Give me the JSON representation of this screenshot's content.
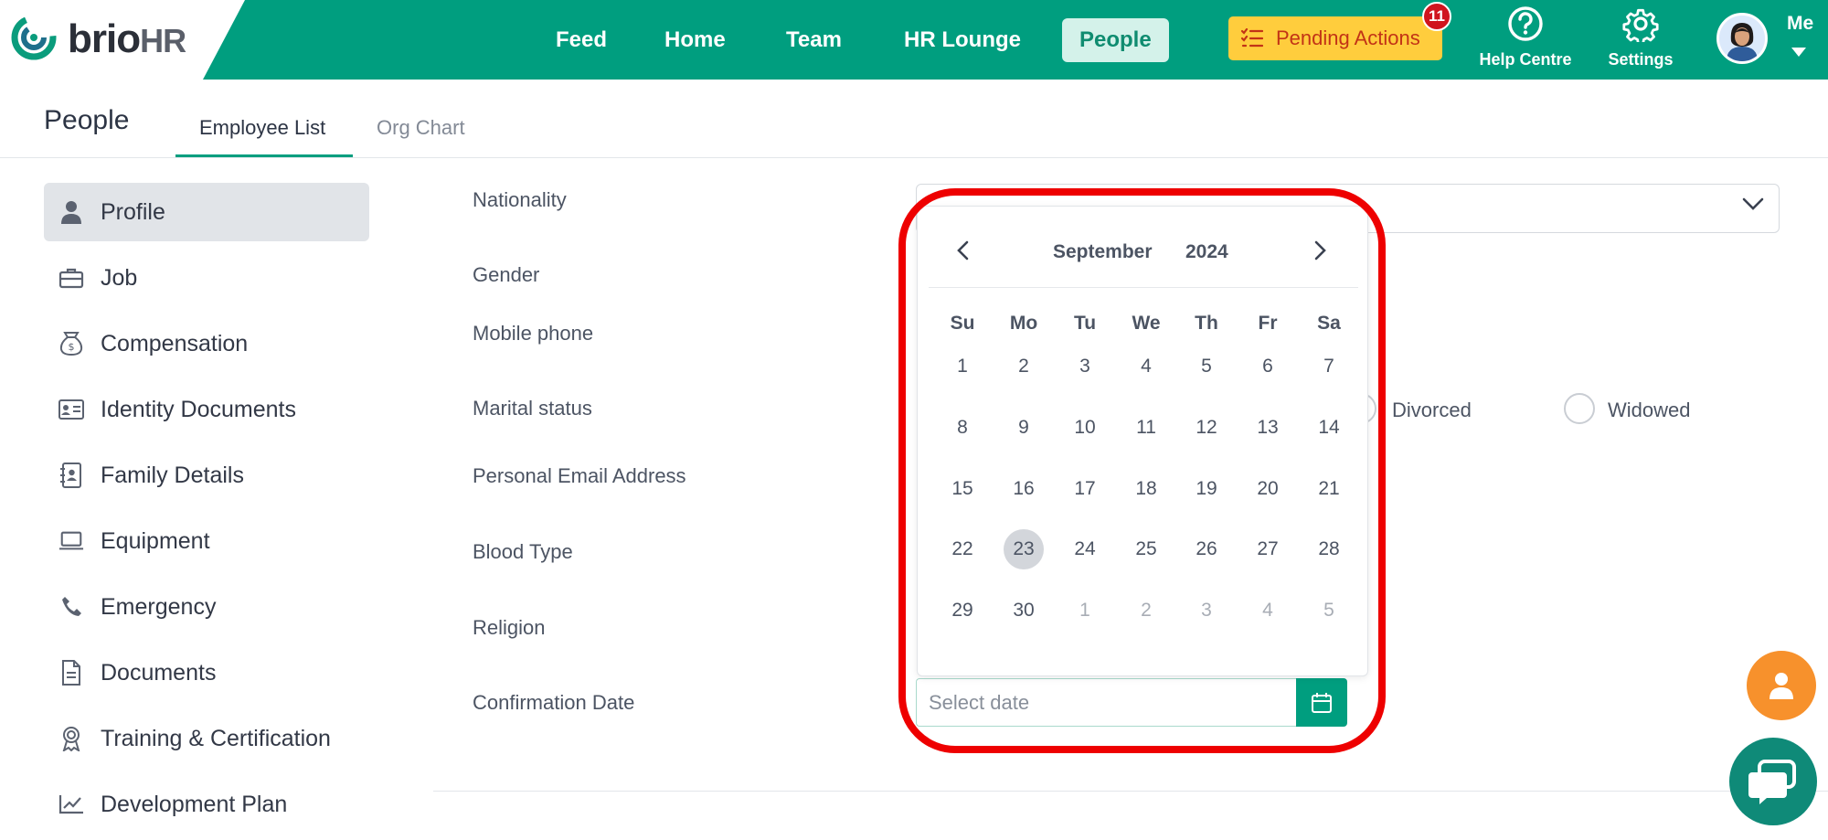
{
  "brand": {
    "name_part1": "brio",
    "name_part2": "HR"
  },
  "nav": {
    "items": [
      {
        "label": "Feed"
      },
      {
        "label": "Home"
      },
      {
        "label": "Team"
      },
      {
        "label": "HR Lounge"
      },
      {
        "label": "People",
        "active": true
      }
    ]
  },
  "pending_actions": {
    "label": "Pending Actions",
    "count": "11"
  },
  "help_centre": {
    "label": "Help Centre"
  },
  "settings": {
    "label": "Settings"
  },
  "user_menu": {
    "label": "Me"
  },
  "page": {
    "title": "People",
    "tabs": [
      {
        "label": "Employee List",
        "active": true
      },
      {
        "label": "Org Chart",
        "active": false
      }
    ]
  },
  "sidebar": {
    "items": [
      {
        "label": "Profile",
        "icon": "person-icon",
        "active": true
      },
      {
        "label": "Job",
        "icon": "briefcase-icon"
      },
      {
        "label": "Compensation",
        "icon": "money-bag-icon"
      },
      {
        "label": "Identity Documents",
        "icon": "id-card-icon"
      },
      {
        "label": "Family Details",
        "icon": "contact-book-icon"
      },
      {
        "label": "Equipment",
        "icon": "laptop-icon"
      },
      {
        "label": "Emergency",
        "icon": "phone-icon"
      },
      {
        "label": "Documents",
        "icon": "document-icon"
      },
      {
        "label": "Training & Certification",
        "icon": "award-icon"
      },
      {
        "label": "Development Plan",
        "icon": "chart-line-icon"
      }
    ]
  },
  "form": {
    "labels": {
      "nationality": "Nationality",
      "gender": "Gender",
      "mobile_phone": "Mobile phone",
      "marital_status": "Marital status",
      "personal_email": "Personal Email Address",
      "blood_type": "Blood Type",
      "religion": "Religion",
      "confirmation_date": "Confirmation Date"
    },
    "marital_options": {
      "divorced": "Divorced",
      "widowed": "Widowed"
    },
    "confirmation_date": {
      "placeholder": "Select date"
    }
  },
  "calendar": {
    "month": "September",
    "year": "2024",
    "weekdays": [
      "Su",
      "Mo",
      "Tu",
      "We",
      "Th",
      "Fr",
      "Sa"
    ],
    "weeks": [
      [
        "1",
        "2",
        "3",
        "4",
        "5",
        "6",
        "7"
      ],
      [
        "8",
        "9",
        "10",
        "11",
        "12",
        "13",
        "14"
      ],
      [
        "15",
        "16",
        "17",
        "18",
        "19",
        "20",
        "21"
      ],
      [
        "22",
        "23",
        "24",
        "25",
        "26",
        "27",
        "28"
      ],
      [
        "29",
        "30",
        "1",
        "2",
        "3",
        "4",
        "5"
      ]
    ],
    "today": "23",
    "accent_color": "#009e7f"
  },
  "colors": {
    "brand_green": "#009e7f",
    "pending_yellow": "#ffcd3d",
    "highlight_red": "#ee0000"
  }
}
